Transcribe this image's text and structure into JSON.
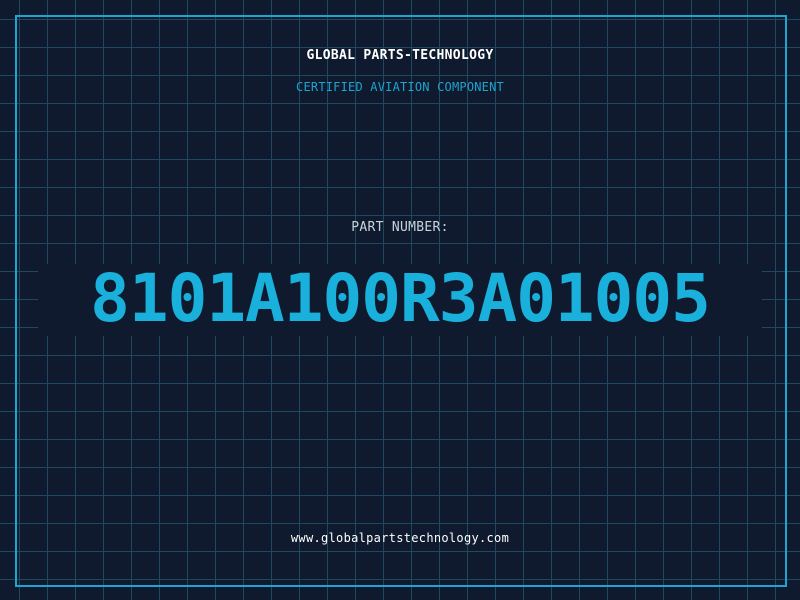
{
  "header": {
    "company": "GLOBAL PARTS-TECHNOLOGY",
    "tagline": "CERTIFIED AVIATION COMPONENT"
  },
  "part": {
    "label": "PART NUMBER:",
    "number": "8101A100R3A01005"
  },
  "footer": {
    "website": "www.globalpartstechnology.com"
  },
  "colors": {
    "background": "#0f1a2e",
    "grid": "#1c4a5e",
    "accent": "#1ea4d0",
    "text": "#ffffff"
  }
}
